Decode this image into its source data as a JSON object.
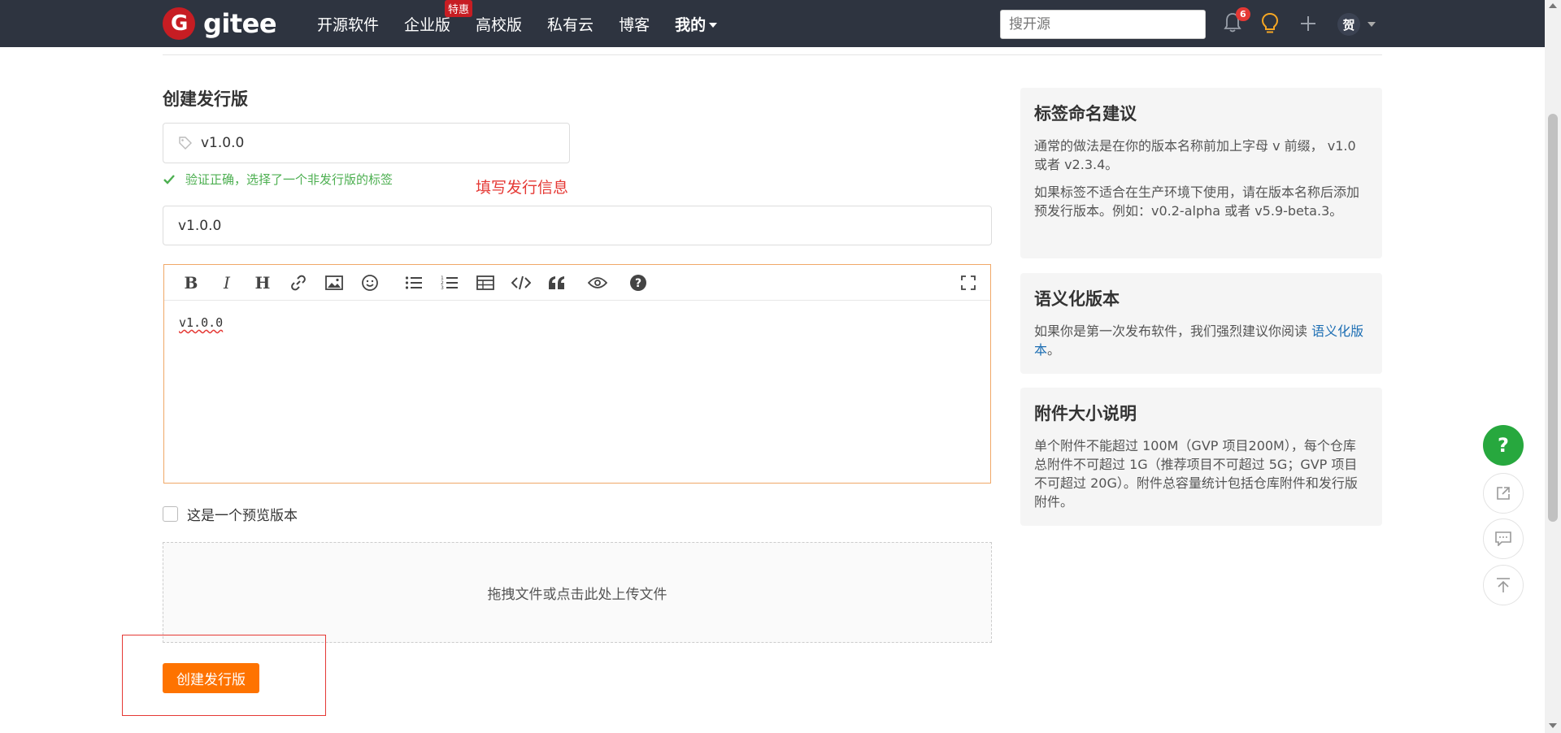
{
  "nav": {
    "logo_text": "gitee",
    "items": [
      {
        "label": "开源软件"
      },
      {
        "label": "企业版",
        "badge": "特惠"
      },
      {
        "label": "高校版"
      },
      {
        "label": "私有云"
      },
      {
        "label": "博客"
      },
      {
        "label": "我的"
      }
    ],
    "search_placeholder": "搜开源",
    "notification_count": "6",
    "avatar_text": "贺"
  },
  "form": {
    "title": "创建发行版",
    "tag_value": "v1.0.0",
    "verify_text": "验证正确，选择了一个非发行版的标签",
    "annotation": "填写发行信息",
    "release_title_value": "v1.0.0",
    "editor_content": "v1.0.0",
    "prerelease_label": "这是一个预览版本",
    "upload_text": "拖拽文件或点击此处上传文件",
    "submit_label": "创建发行版"
  },
  "sidebar": {
    "tag_naming": {
      "title": "标签命名建议",
      "p1": "通常的做法是在你的版本名称前加上字母 v 前缀， v1.0 或者 v2.3.4。",
      "p2": "如果标签不适合在生产环境下使用，请在版本名称后添加预发行版本。例如：v0.2-alpha 或者 v5.9-beta.3。"
    },
    "semver": {
      "title": "语义化版本",
      "text": "如果你是第一次发布软件，我们强烈建议你阅读 ",
      "link": "语义化版本",
      "suffix": "。"
    },
    "attachment": {
      "title": "附件大小说明",
      "text": "单个附件不能超过 100M（GVP 项目200M），每个仓库总附件不可超过 1G（推荐项目不可超过 5G；GVP 项目不可超过 20G）。附件总容量统计包括仓库附件和发行版附件。"
    }
  },
  "floating": {
    "help_label": "?"
  },
  "colors": {
    "nav_bg": "#2e3440",
    "brand_red": "#c71d23",
    "accent_orange": "#fe7300",
    "success_green": "#4caf50",
    "annotation_red": "#e53935"
  }
}
